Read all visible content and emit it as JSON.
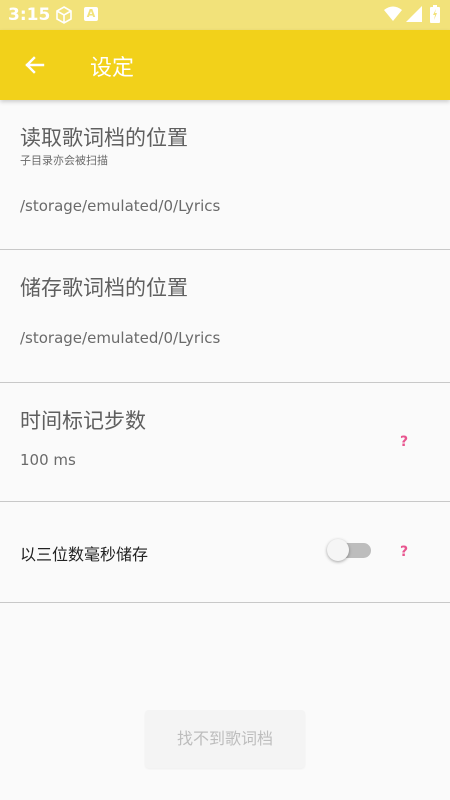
{
  "status_bar": {
    "time": "3:15",
    "icons": [
      "cube-icon",
      "a-icon",
      "wifi-icon",
      "signal-icon",
      "battery-icon"
    ]
  },
  "app_bar": {
    "title": "设定",
    "back_icon": "arrow-left-icon"
  },
  "settings": {
    "read_location": {
      "title": "读取歌词档的位置",
      "subtitle": "子目录亦会被扫描",
      "value": "/storage/emulated/0/Lyrics"
    },
    "save_location": {
      "title": "储存歌词档的位置",
      "value": "/storage/emulated/0/Lyrics"
    },
    "time_step": {
      "title": "时间标记步数",
      "value": "100 ms",
      "help": "?"
    },
    "millis_save": {
      "label": "以三位数毫秒储存",
      "enabled": false,
      "help": "?"
    }
  },
  "footer": {
    "not_found_label": "找不到歌词档"
  },
  "colors": {
    "accent": "#f2d11a",
    "status_bar": "#f2e27a",
    "help": "#e8558f"
  }
}
